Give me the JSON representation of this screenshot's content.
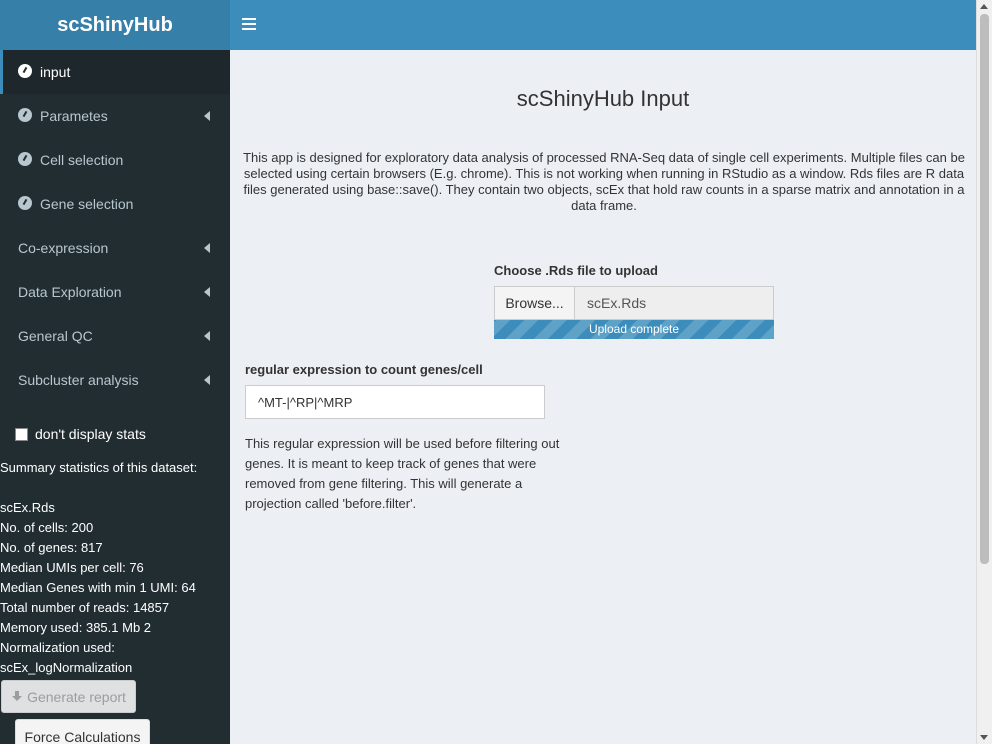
{
  "app": {
    "title": "scShinyHub"
  },
  "sidebar": {
    "items": [
      {
        "label": "input",
        "icon": "dashboard-icon",
        "active": true,
        "expandable": false
      },
      {
        "label": "Parametes",
        "icon": "dashboard-icon",
        "active": false,
        "expandable": true
      },
      {
        "label": "Cell selection",
        "icon": "dashboard-icon",
        "active": false,
        "expandable": false
      },
      {
        "label": "Gene selection",
        "icon": "dashboard-icon",
        "active": false,
        "expandable": false
      },
      {
        "label": "Co-expression",
        "icon": null,
        "active": false,
        "expandable": true
      },
      {
        "label": "Data Exploration",
        "icon": null,
        "active": false,
        "expandable": true
      },
      {
        "label": "General QC",
        "icon": null,
        "active": false,
        "expandable": true
      },
      {
        "label": "Subcluster analysis",
        "icon": null,
        "active": false,
        "expandable": true
      }
    ],
    "checkbox_label": "don't display stats",
    "checkbox_checked": false,
    "stats": {
      "heading": "Summary statistics of this dataset:",
      "lines": [
        "scEx.Rds",
        "No. of cells: 200",
        "No. of genes: 817",
        "Median UMIs per cell: 76",
        "Median Genes with min 1 UMI: 64",
        "Total number of reads: 14857",
        "Memory used: 385.1 Mb 2",
        "Normalization used:",
        "scEx_logNormalization"
      ]
    },
    "generate_report_label": "Generate report",
    "force_calc_label": "Force Calculations"
  },
  "main": {
    "title": "scShinyHub Input",
    "intro": "This app is designed for exploratory data analysis of processed RNA-Seq data of single cell experiments. Multiple files can be selected using certain browsers (E.g. chrome). This is not working when running in RStudio as a window. Rds files are R data files generated using base::save(). They contain two objects, scEx that hold raw counts in a sparse matrix and annotation in a data frame.",
    "upload": {
      "label": "Choose .Rds file to upload",
      "browse_label": "Browse...",
      "file_name": "scEx.Rds",
      "progress_text": "Upload complete",
      "progress": 1.0
    },
    "regex": {
      "label": "regular expression to count genes/cell",
      "value": "^MT-|^RP|^MRP",
      "help": "This regular expression will be used before filtering out genes. It is meant to keep track of genes that were removed from gene filtering. This will generate a projection called 'before.filter'."
    }
  },
  "colors": {
    "header": "#3c8dbc",
    "logo_bg": "#367fa9",
    "sidebar_bg": "#222d32",
    "content_bg": "#ecf0f5"
  }
}
